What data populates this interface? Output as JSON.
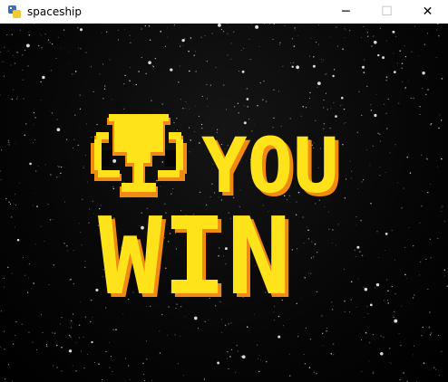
{
  "window": {
    "title": "spaceship",
    "icon": "python-icon",
    "controls": {
      "minimize": "─",
      "maximize": "☐",
      "close": "✕"
    }
  },
  "game": {
    "message_line1": "YOU",
    "message_line2": "WIN",
    "trophy_icon": "trophy-icon",
    "colors": {
      "text_main": "#ffe31a",
      "text_shadow": "#f08a14",
      "background": "#000000",
      "star": "#ffffff"
    }
  }
}
